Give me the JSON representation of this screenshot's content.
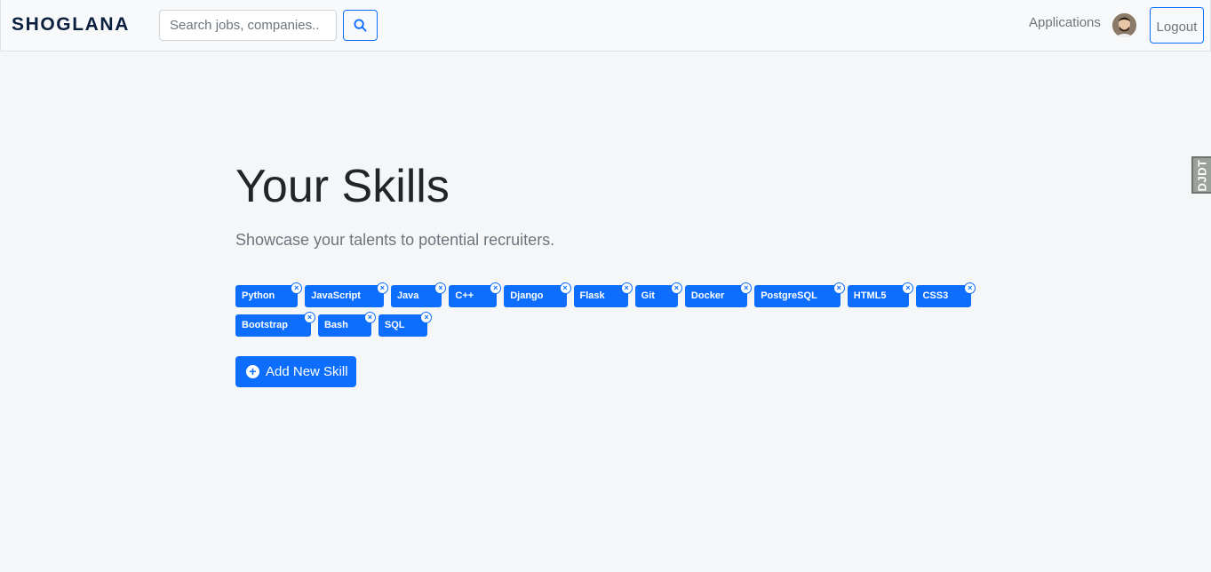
{
  "navbar": {
    "brand": "SHOGLANA",
    "search_placeholder": "Search jobs, companies..",
    "applications_label": "Applications",
    "logout_label": "Logout"
  },
  "side_tab": {
    "label": "DJDT"
  },
  "main": {
    "title": "Your Skills",
    "subtitle": "Showcase your talents to potential recruiters.",
    "skills_row1": [
      "Python",
      "JavaScript",
      "Java",
      "C++",
      "Django",
      "Flask",
      "Git",
      "Docker",
      "PostgreSQL",
      "HTML5",
      "CSS3"
    ],
    "skills_row2": [
      "Bootstrap",
      "Bash",
      "SQL"
    ],
    "remove_glyph": "×",
    "add_button_label": "Add New Skill"
  },
  "colors": {
    "accent": "#0d6efd",
    "background": "#f5f6f8",
    "brand": "#0b1f3f",
    "muted_text": "#6c757d"
  },
  "icons": {
    "search": "search-icon",
    "add": "plus-circle-icon",
    "remove": "close-icon"
  }
}
